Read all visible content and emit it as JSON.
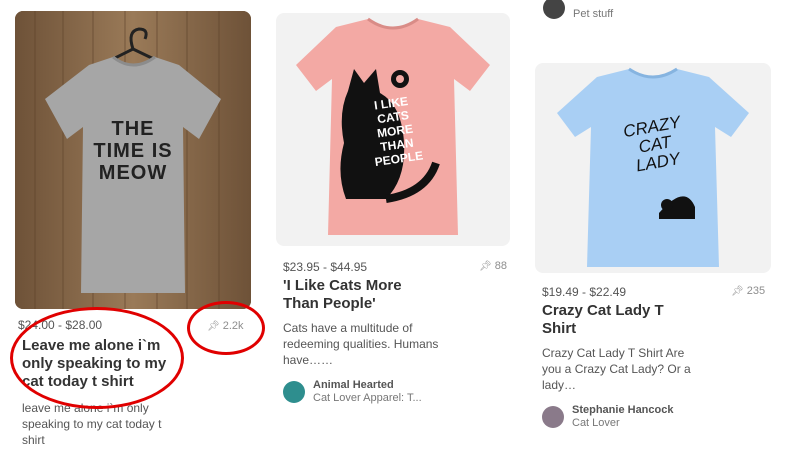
{
  "top_board": {
    "label": "Pet stuff"
  },
  "pins": [
    {
      "price": "$24.00 - $28.00",
      "saves": "2.2k",
      "title": "Leave me alone i`m only speaking to my cat today t shirt",
      "description": "leave me alone i`m only speaking to my cat today t shirt",
      "shirt_text": [
        "THE",
        "TIME IS",
        "MEOW"
      ]
    },
    {
      "price": "$23.95 - $44.95",
      "saves": "88",
      "title": "'I Like Cats More Than People'",
      "description": "Cats have a multitude of redeeming qualities. Humans have……",
      "attribution": {
        "name": "Animal Hearted",
        "board": "Cat Lover Apparel: T..."
      },
      "shirt_text": [
        "I LIKE",
        "CATS",
        "MORE",
        "THAN",
        "PEOPLE"
      ]
    },
    {
      "price": "$19.49 - $22.49",
      "saves": "235",
      "title": "Crazy Cat Lady T Shirt",
      "description": "Crazy Cat Lady T Shirt Are you a Crazy Cat Lady? Or a lady…",
      "attribution": {
        "name": "Stephanie Hancock",
        "board": "Cat Lover"
      },
      "shirt_text": [
        "CRAZY",
        "CAT",
        "LADY"
      ]
    }
  ],
  "colors": {
    "annotation": "#e00000",
    "pink_shirt": "#f3a9a4",
    "blue_shirt": "#a9cff4",
    "grey_shirt": "#a6a6a6",
    "wood": "#8a6a4a"
  }
}
